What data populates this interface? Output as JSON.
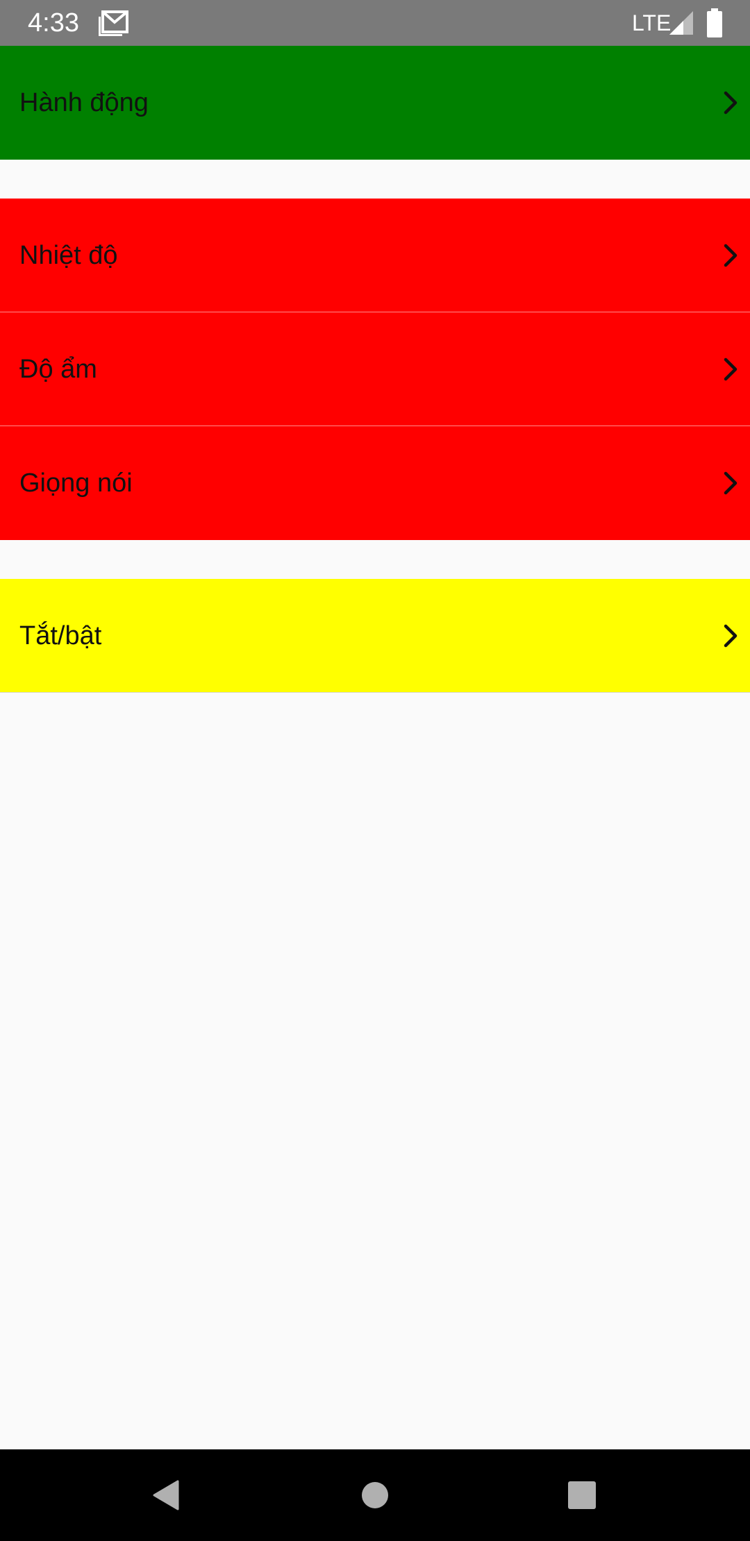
{
  "status_bar": {
    "time": "4:33",
    "network": "LTE",
    "background": "#7a7a7a"
  },
  "groups": [
    {
      "color": "#008000",
      "items": [
        {
          "label": "Hành động"
        }
      ]
    },
    {
      "color": "#ff0000",
      "items": [
        {
          "label": "Nhiệt độ"
        },
        {
          "label": "Độ ẩm"
        },
        {
          "label": "Giọng nói"
        }
      ]
    },
    {
      "color": "#ffff00",
      "items": [
        {
          "label": "Tắt/bật"
        }
      ]
    }
  ],
  "icons": {
    "notification": "mail-icon",
    "row_arrow": "chevron-right-icon",
    "nav": [
      "back-icon",
      "home-icon",
      "recents-icon"
    ]
  },
  "colors": {
    "page_background": "#fafafa",
    "nav_bar": "#000000",
    "nav_icons": "#b0b0b0"
  }
}
